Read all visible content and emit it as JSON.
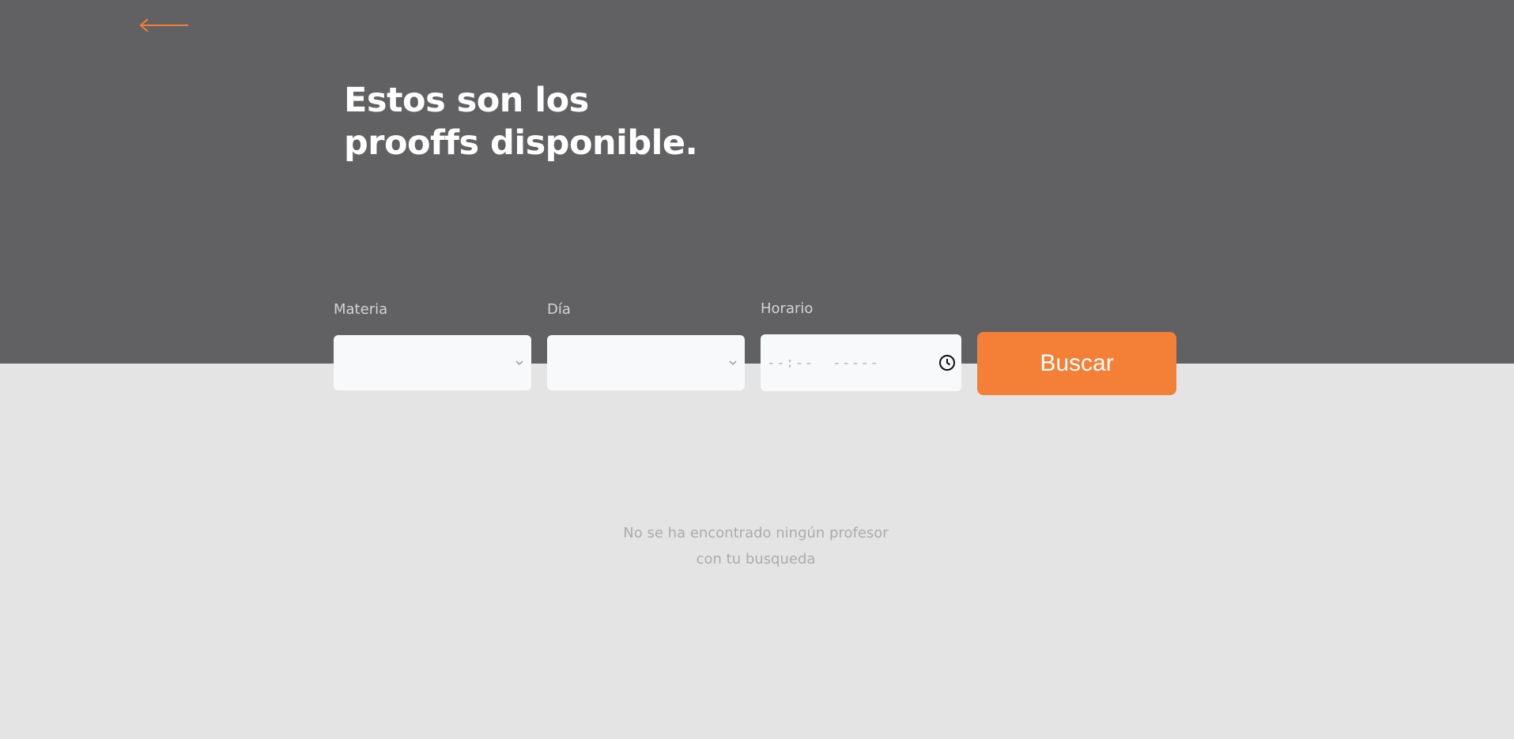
{
  "header": {
    "back_icon": "arrow-left-icon",
    "title_line1": "Estos son los",
    "title_line2": "prooffs disponible.",
    "accent_color": "#f47f36"
  },
  "filters": {
    "subject": {
      "label": "Materia",
      "value": ""
    },
    "day": {
      "label": "Día",
      "value": ""
    },
    "time": {
      "label": "Horario",
      "value": "--:--  -----",
      "icon": "clock-icon"
    },
    "search_label": "Buscar"
  },
  "results": {
    "empty_line1": "No se ha encontrado ningún profesor",
    "empty_line2": "con tu busqueda"
  }
}
